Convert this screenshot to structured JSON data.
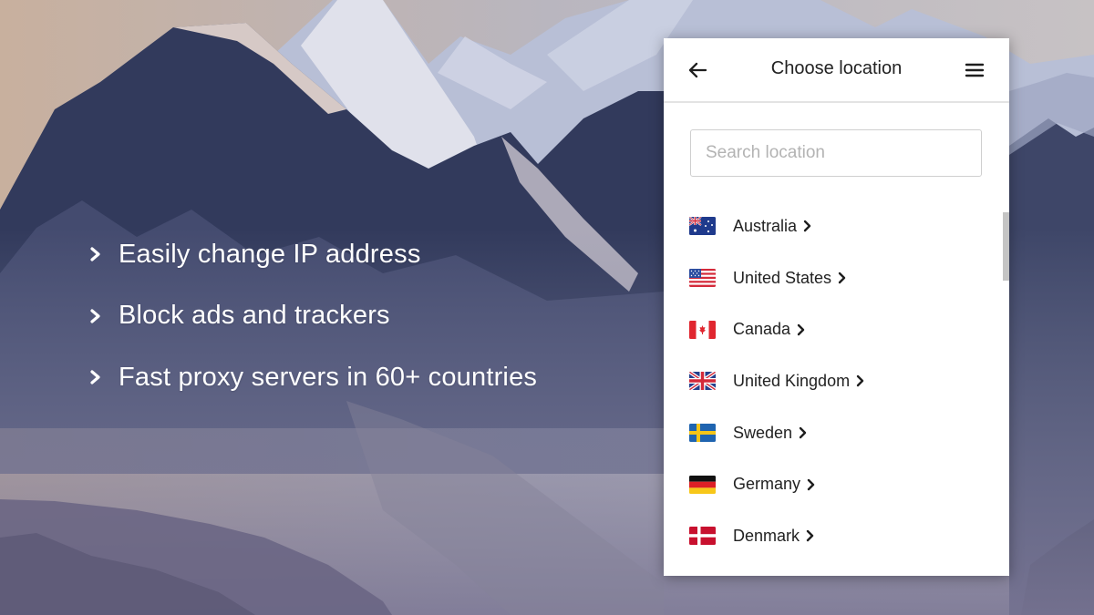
{
  "background": {
    "description": "misty mountain range at dusk",
    "colors": {
      "sky": "#c9b9ae",
      "haze": "#7e82a0",
      "dark_ridge": "#2f3655"
    }
  },
  "features": [
    {
      "icon": "chevron-right-icon",
      "label": "Easily change IP address"
    },
    {
      "icon": "chevron-right-icon",
      "label": "Block ads and trackers"
    },
    {
      "icon": "chevron-right-icon",
      "label": "Fast proxy servers in 60+ countries"
    }
  ],
  "panel": {
    "header": {
      "back_icon": "arrow-left-icon",
      "title": "Choose location",
      "menu_icon": "hamburger-menu-icon"
    },
    "search": {
      "placeholder": "Search location",
      "value": ""
    },
    "locations": [
      {
        "name": "Australia",
        "flag": "flag-australia-icon"
      },
      {
        "name": "United States",
        "flag": "flag-united-states-icon"
      },
      {
        "name": "Canada",
        "flag": "flag-canada-icon"
      },
      {
        "name": "United Kingdom",
        "flag": "flag-united-kingdom-icon"
      },
      {
        "name": "Sweden",
        "flag": "flag-sweden-icon"
      },
      {
        "name": "Germany",
        "flag": "flag-germany-icon"
      },
      {
        "name": "Denmark",
        "flag": "flag-denmark-icon"
      }
    ],
    "scroll_position": 0.0
  }
}
